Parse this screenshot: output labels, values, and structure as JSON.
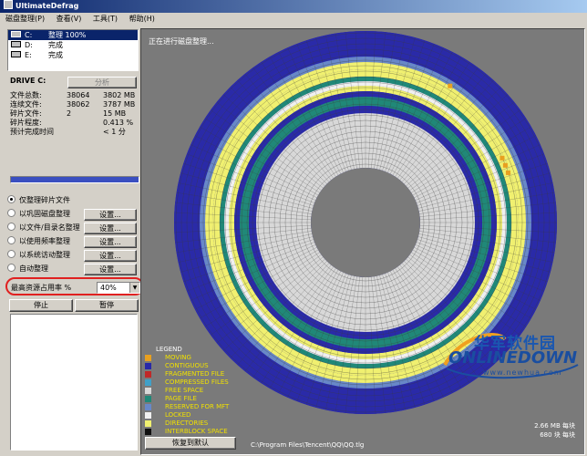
{
  "window": {
    "title": "UltimateDefrag"
  },
  "menu": [
    "磁盘整理(P)",
    "查看(V)",
    "工具(T)",
    "帮助(H)"
  ],
  "drives": [
    {
      "name": "C:",
      "status": "整理 100%",
      "selected": true
    },
    {
      "name": "D:",
      "status": "完成",
      "selected": false
    },
    {
      "name": "E:",
      "status": "完成",
      "selected": false
    }
  ],
  "drive_panel": {
    "title": "DRIVE C:",
    "analyze_label": "分析",
    "stats": [
      {
        "label": "文件总数:",
        "v1": "38064",
        "v2": "3802 MB"
      },
      {
        "label": "连续文件:",
        "v1": "38062",
        "v2": "3787 MB"
      },
      {
        "label": "碎片文件:",
        "v1": "2",
        "v2": "15 MB"
      },
      {
        "label": "碎片程度:",
        "v1": "",
        "v2": "0.413 %"
      },
      {
        "label": "预计完成时间",
        "v1": "",
        "v2": "< 1 分"
      }
    ],
    "progress": 1.0
  },
  "options": [
    {
      "label": "仅整理碎片文件",
      "selected": true,
      "settings": ""
    },
    {
      "label": "以巩固磁盘整理",
      "selected": false,
      "settings": "设置..."
    },
    {
      "label": "以文件/目录名整理",
      "selected": false,
      "settings": "设置..."
    },
    {
      "label": "以使用频率整理",
      "selected": false,
      "settings": "设置..."
    },
    {
      "label": "以系统访动整理",
      "selected": false,
      "settings": "设置..."
    },
    {
      "label": "自动整理",
      "selected": false,
      "settings": "设置..."
    }
  ],
  "max_resource": {
    "label": "最高资源占用率 %",
    "value": "40%"
  },
  "controls": {
    "stop": "停止",
    "pause": "暂停"
  },
  "map": {
    "status": "正在进行磁盘整理...",
    "legend_title": "LEGEND",
    "legend": [
      {
        "name": "MOVING",
        "color": "#e8a020"
      },
      {
        "name": "CONTIGUOUS",
        "color": "#2828a8"
      },
      {
        "name": "FRAGMENTED FILE",
        "color": "#c02828"
      },
      {
        "name": "COMPRESSED FILES",
        "color": "#40a0c8"
      },
      {
        "name": "FREE SPACE",
        "color": "#d8d8d8"
      },
      {
        "name": "PAGE FILE",
        "color": "#208878"
      },
      {
        "name": "RESERVED FOR MFT",
        "color": "#6888c8"
      },
      {
        "name": "LOCKED",
        "color": "#f0f0f0"
      },
      {
        "name": "DIRECTORIES",
        "color": "#f0f070"
      },
      {
        "name": "INTERBLOCK SPACE",
        "color": "#101010"
      }
    ],
    "restore_label": "恢复到默认",
    "path": "C:\\Program Files\\Tencent\\QQ\\QQ.tlg",
    "block_size": "2.66 MB 每块",
    "block_count": "680 块 每块"
  },
  "watermark": {
    "cn": "华军软件园",
    "en": "ONLINEDOWN",
    "url": "www.newhua.com"
  }
}
